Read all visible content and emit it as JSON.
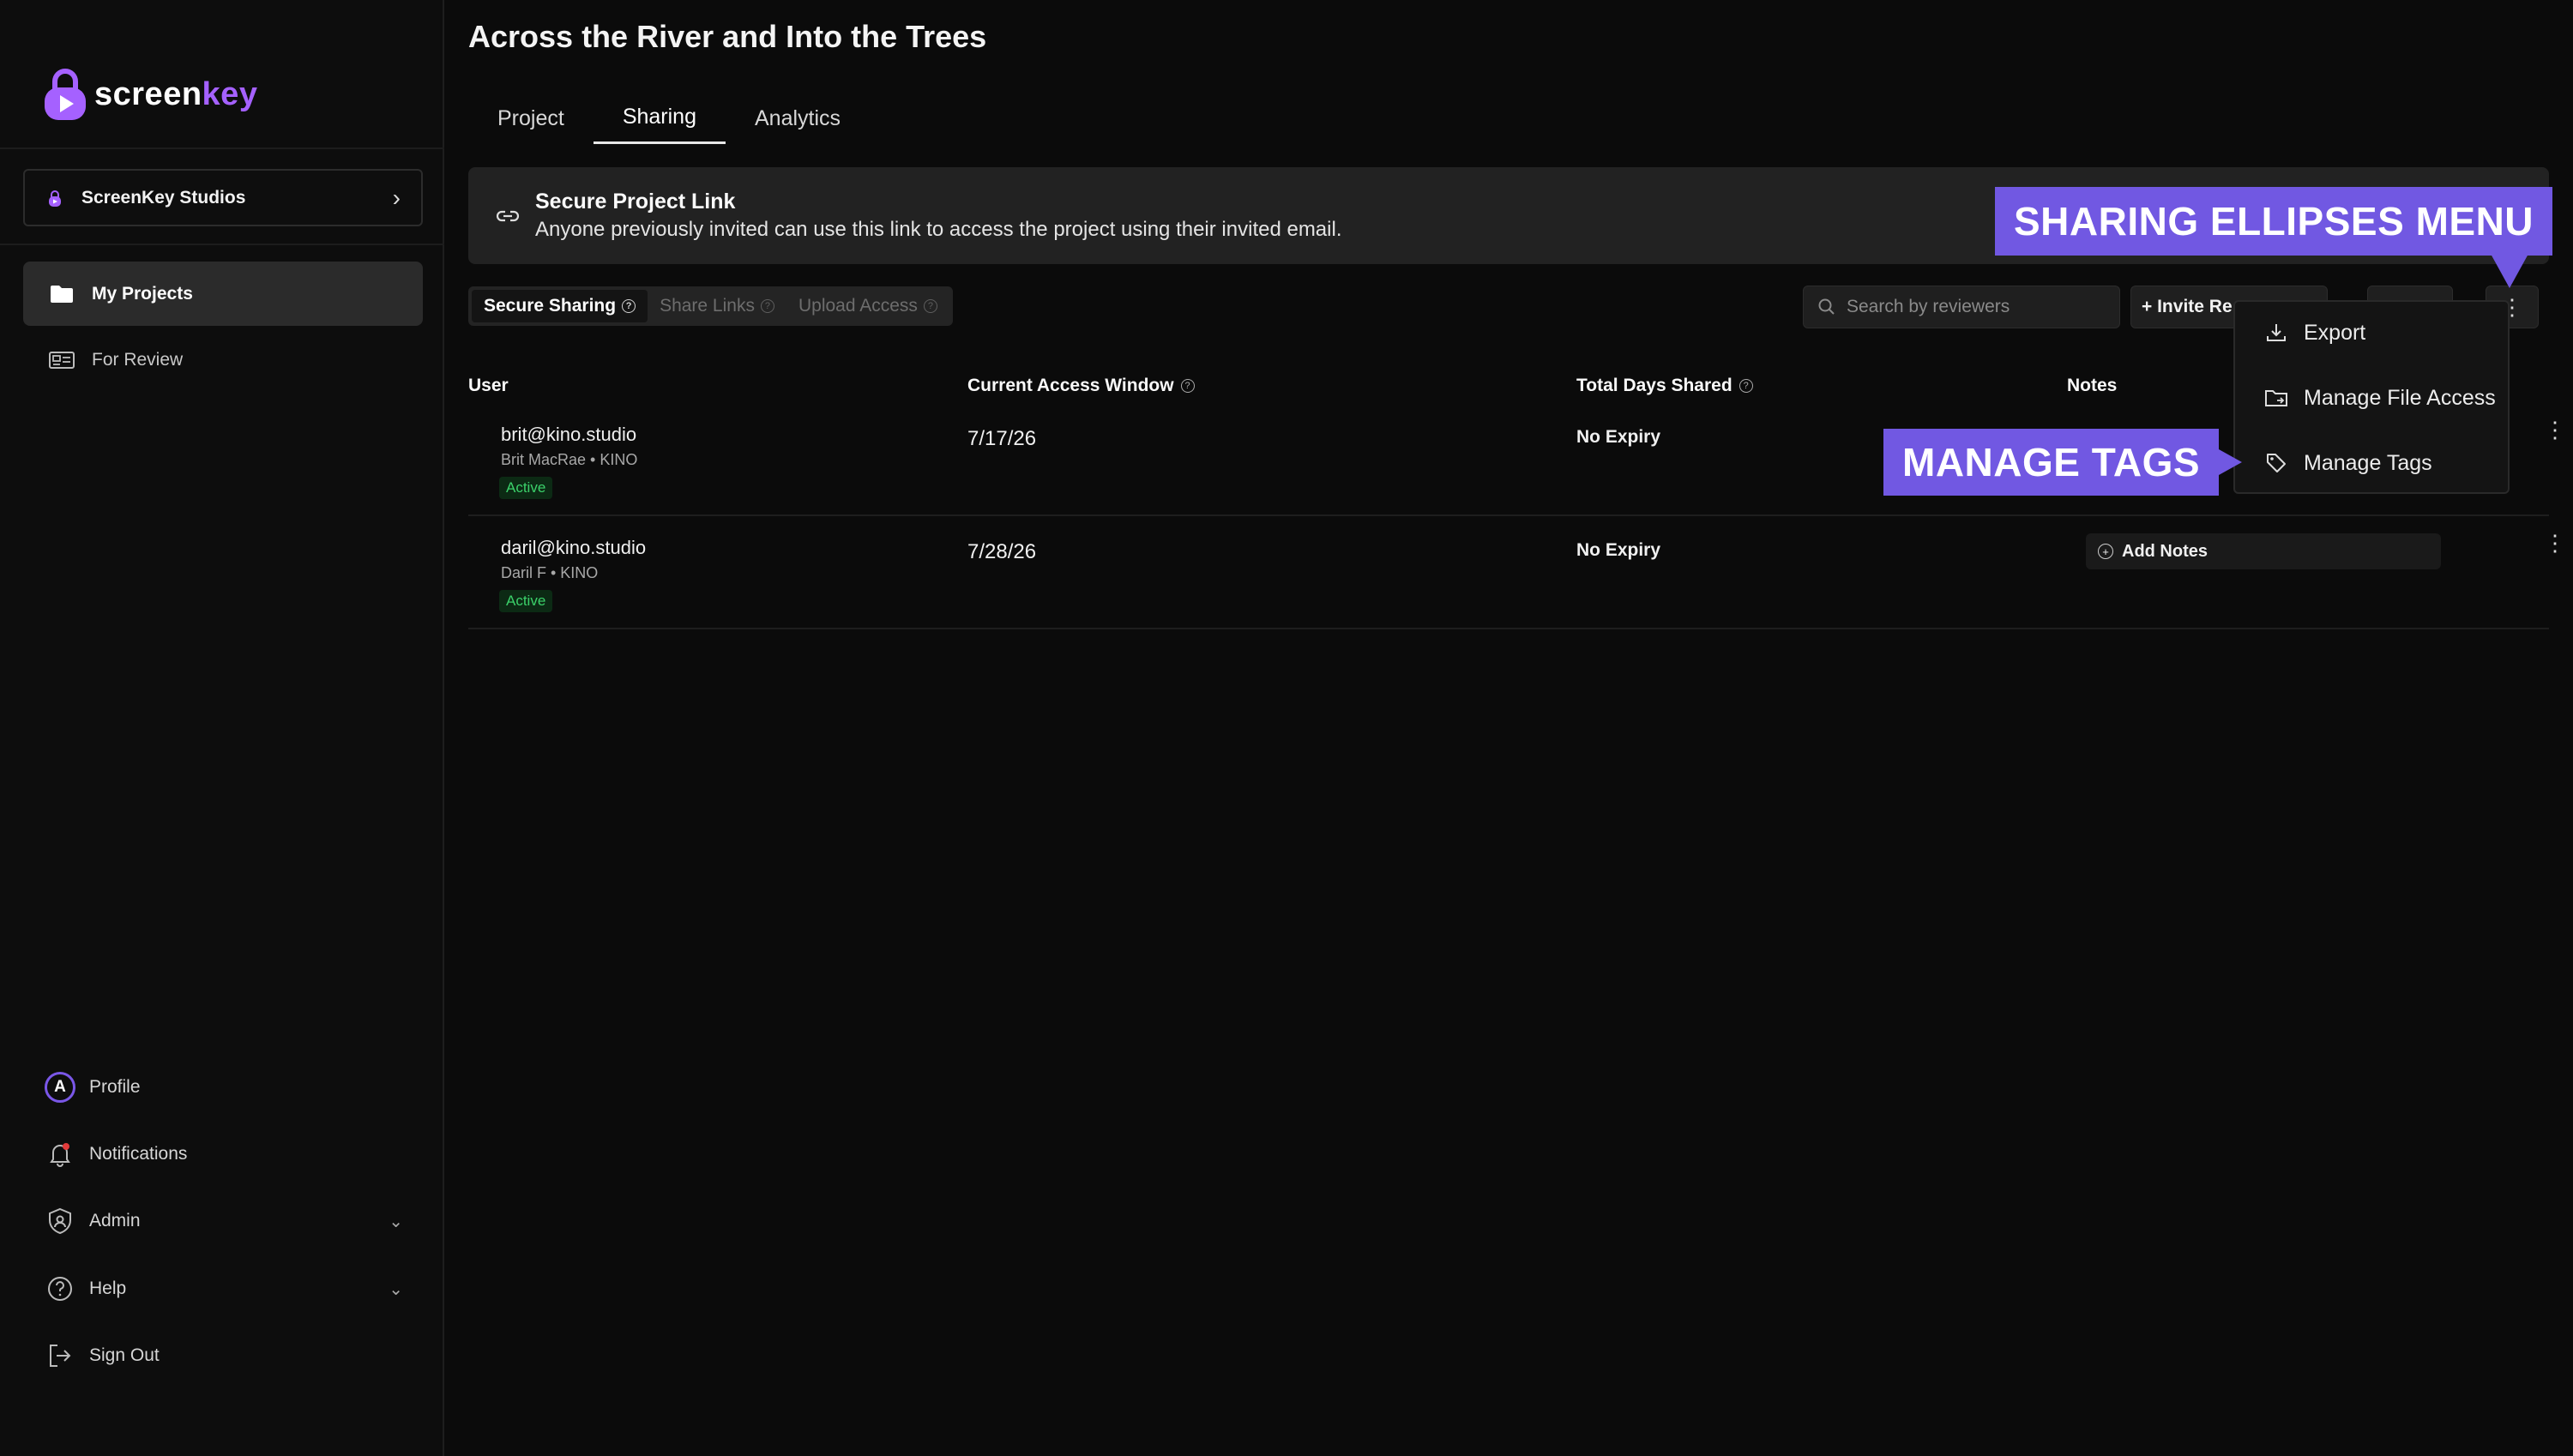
{
  "brand": {
    "name_part1": "screen",
    "name_part2": "key",
    "accent": "#a561ff"
  },
  "sidebar": {
    "org": {
      "name": "ScreenKey Studios"
    },
    "nav": [
      {
        "label": "My Projects",
        "icon": "folder-icon",
        "active": true
      },
      {
        "label": "For Review",
        "icon": "review-icon",
        "active": false
      }
    ],
    "bottom": [
      {
        "label": "Profile",
        "icon": "avatar",
        "initial": "A"
      },
      {
        "label": "Notifications",
        "icon": "bell-icon"
      },
      {
        "label": "Admin",
        "icon": "shield-icon"
      },
      {
        "label": "Help",
        "icon": "help-icon"
      },
      {
        "label": "Sign Out",
        "icon": "sign-out-icon"
      }
    ]
  },
  "page": {
    "title": "Across the River and Into the Trees",
    "tabs": [
      {
        "label": "Project",
        "active": false
      },
      {
        "label": "Sharing",
        "active": true
      },
      {
        "label": "Analytics",
        "active": false
      }
    ]
  },
  "banner": {
    "title": "Secure Project Link",
    "description": "Anyone previously invited can use this link to access the project using their invited email."
  },
  "subtabs": [
    {
      "label": "Secure Sharing",
      "active": true
    },
    {
      "label": "Share Links",
      "active": false
    },
    {
      "label": "Upload Access",
      "active": false
    }
  ],
  "toolbar": {
    "search_placeholder": "Search by reviewers",
    "invite_label": "+ Invite Re"
  },
  "table": {
    "headers": {
      "user": "User",
      "access_window": "Current Access Window",
      "days_shared": "Total Days Shared",
      "notes": "Notes"
    },
    "rows": [
      {
        "email": "brit@kino.studio",
        "sub": "Brit MacRae • KINO",
        "status": "Active",
        "date": "7/17/26",
        "expiry": "No Expiry",
        "notes": ""
      },
      {
        "email": "daril@kino.studio",
        "sub": "Daril F • KINO",
        "status": "Active",
        "date": "7/28/26",
        "expiry": "No Expiry",
        "notes": "Add Notes"
      }
    ]
  },
  "menu": {
    "items": [
      {
        "label": "Export",
        "icon": "download-icon"
      },
      {
        "label": "Manage File Access",
        "icon": "folder-access-icon"
      },
      {
        "label": "Manage Tags",
        "icon": "tag-icon"
      }
    ]
  },
  "callouts": {
    "ellipses": "SHARING ELLIPSES MENU",
    "tags": "MANAGE TAGS",
    "color": "#7158e2"
  }
}
